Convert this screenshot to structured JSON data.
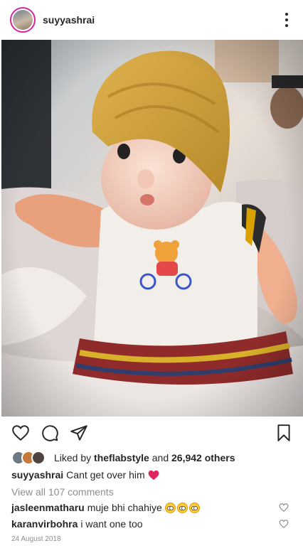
{
  "header": {
    "username": "suyyashrai",
    "avatar_icon": "profile-avatar",
    "more_icon": "more-vertical-icon"
  },
  "photo": {
    "icon": "photo-of-doll-with-turban"
  },
  "actions": {
    "like_icon": "heart-outline-icon",
    "comment_icon": "comment-bubble-icon",
    "share_icon": "paper-plane-icon",
    "save_icon": "bookmark-icon"
  },
  "likes": {
    "prefix": "Liked by",
    "user": "theflabstyle",
    "and": "and",
    "count": "26,942 others"
  },
  "caption": {
    "username": "suyyashrai",
    "text": "Cant get over him",
    "emoji": "red-heart-emoji"
  },
  "view_comments": "View all 107 comments",
  "comments": [
    {
      "username": "jasleenmatharu",
      "text": "muje bhi chahiye",
      "emoji_count": 3
    },
    {
      "username": "karanvirbohra",
      "text": "i want one too"
    }
  ],
  "date": "24 August 2018",
  "colors": {
    "text": "#262626",
    "muted": "#8e8e8e",
    "heart_red": "#e0245e",
    "story_ring": "#d6249f"
  }
}
